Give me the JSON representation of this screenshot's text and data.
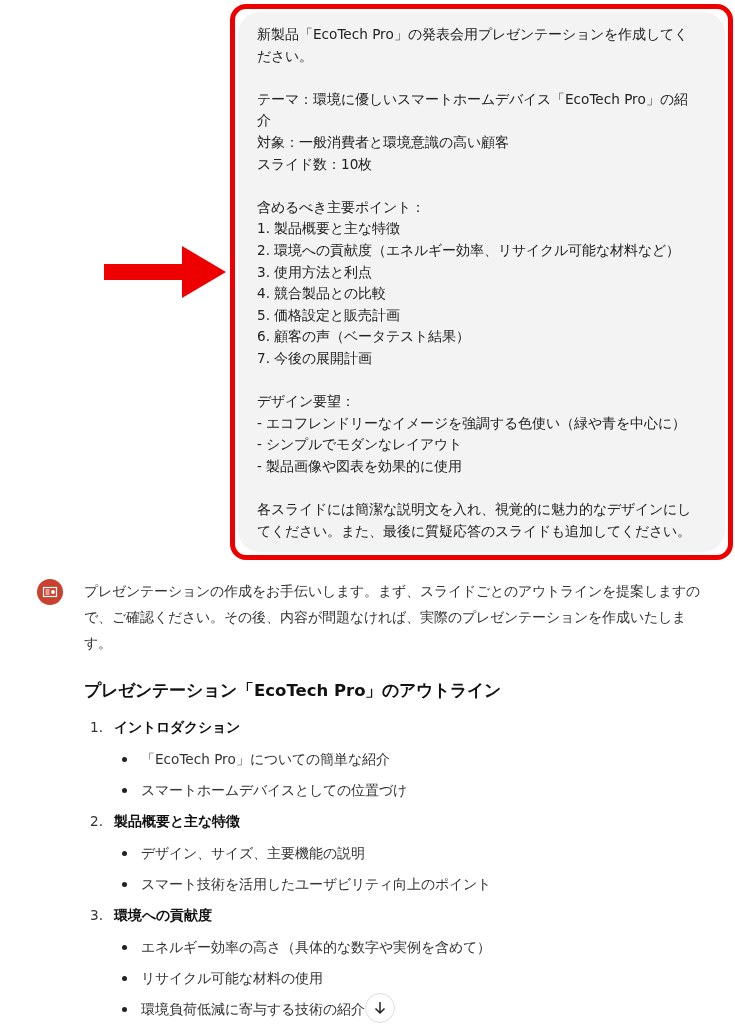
{
  "user_message": {
    "highlighted": true,
    "paragraphs": [
      [
        "新製品「EcoTech Pro」の発表会用プレゼンテーションを作成してください。"
      ],
      [
        "テーマ：環境に優しいスマートホームデバイス「EcoTech Pro」の紹介",
        "対象：一般消費者と環境意識の高い顧客",
        "スライド数：10枚"
      ],
      [
        "含めるべき主要ポイント：",
        "1. 製品概要と主な特徴",
        "2. 環境への貢献度（エネルギー効率、リサイクル可能な材料など）",
        "3. 使用方法と利点",
        "4. 競合製品との比較",
        "5. 価格設定と販売計画",
        "6. 顧客の声（ベータテスト結果）",
        "7. 今後の展開計画"
      ],
      [
        "デザイン要望：",
        "- エコフレンドリーなイメージを強調する色使い（緑や青を中心に）",
        "- シンプルでモダンなレイアウト",
        "- 製品画像や図表を効果的に使用"
      ],
      [
        "各スライドには簡潔な説明文を入れ、視覚的に魅力的なデザインにしてください。また、最後に質疑応答のスライドも追加してください。"
      ]
    ]
  },
  "assistant_message": {
    "intro": "プレゼンテーションの作成をお手伝いします。まず、スライドごとのアウトラインを提案しますので、ご確認ください。その後、内容が問題なければ、実際のプレゼンテーションを作成いたします。",
    "heading": "プレゼンテーション「EcoTech Pro」のアウトライン",
    "outline": [
      {
        "number": "1.",
        "title": "イントロダクション",
        "children": [
          "「EcoTech Pro」についての簡単な紹介",
          "スマートホームデバイスとしての位置づけ"
        ]
      },
      {
        "number": "2.",
        "title": "製品概要と主な特徴",
        "children": [
          "デザイン、サイズ、主要機能の説明",
          "スマート技術を活用したユーザビリティ向上のポイント"
        ]
      },
      {
        "number": "3.",
        "title": "環境への貢献度",
        "children": [
          "エネルギー効率の高さ（具体的な数字や実例を含めて）",
          "リサイクル可能な材料の使用",
          "環境負荷低減に寄与する技術の紹介"
        ]
      }
    ]
  }
}
